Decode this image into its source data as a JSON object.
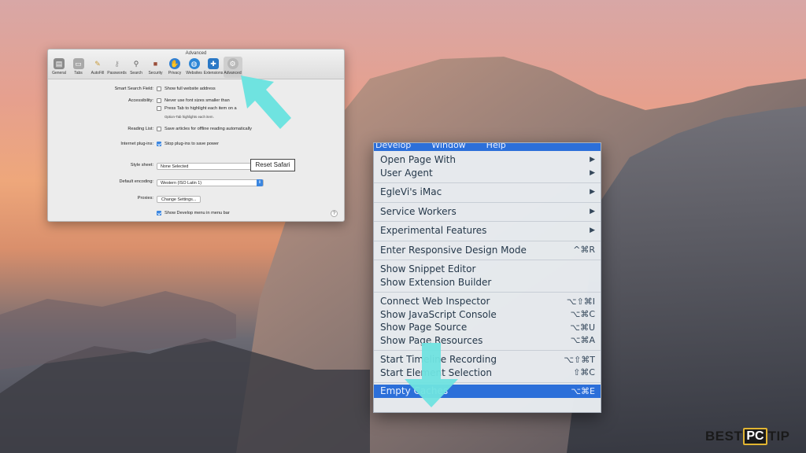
{
  "prefs": {
    "title": "Advanced",
    "tabs": [
      {
        "label": "General",
        "icon": "general-icon"
      },
      {
        "label": "Tabs",
        "icon": "tabs-icon"
      },
      {
        "label": "AutoFill",
        "icon": "autofill-icon"
      },
      {
        "label": "Passwords",
        "icon": "key-icon"
      },
      {
        "label": "Search",
        "icon": "search-icon"
      },
      {
        "label": "Security",
        "icon": "lock-icon"
      },
      {
        "label": "Privacy",
        "icon": "hand-icon"
      },
      {
        "label": "Websites",
        "icon": "globe-icon"
      },
      {
        "label": "Extensions",
        "icon": "puzzle-icon"
      },
      {
        "label": "Advanced",
        "icon": "gear-icon"
      }
    ],
    "smart_search_label": "Smart Search Field:",
    "smart_search_option": "Show full website address",
    "accessibility_label": "Accessibility:",
    "accessibility_opt1": "Never use font sizes smaller than",
    "accessibility_opt2": "Press Tab to highlight each item on a",
    "accessibility_note": "Option-Tab highlights each item.",
    "reading_list_label": "Reading List:",
    "reading_list_option": "Save articles for offline reading automatically",
    "plugins_label": "Internet plug-ins:",
    "plugins_option": "Stop plug-ins to save power",
    "style_sheet_label": "Style sheet:",
    "style_sheet_value": "None Selected",
    "encoding_label": "Default encoding:",
    "encoding_value": "Western (ISO Latin 1)",
    "proxies_label": "Proxies:",
    "proxies_button": "Change Settings...",
    "develop_option": "Show Develop menu in menu bar",
    "tooltip": "Reset Safari",
    "help": "?"
  },
  "menu": {
    "menubar": [
      "Develop",
      "Window",
      "Help"
    ],
    "groups": [
      [
        {
          "label": "Open Page With",
          "sc": "▶"
        },
        {
          "label": "User Agent",
          "sc": "▶"
        }
      ],
      [
        {
          "label": "EgleVi's iMac",
          "sc": "▶"
        }
      ],
      [
        {
          "label": "Service Workers",
          "sc": "▶"
        }
      ],
      [
        {
          "label": "Experimental Features",
          "sc": "▶"
        }
      ],
      [
        {
          "label": "Enter Responsive Design Mode",
          "sc": "^⌘R"
        }
      ],
      [
        {
          "label": "Show Snippet Editor",
          "sc": ""
        },
        {
          "label": "Show Extension Builder",
          "sc": ""
        }
      ],
      [
        {
          "label": "Connect Web Inspector",
          "sc": "⌥⇧⌘I"
        },
        {
          "label": "Show JavaScript Console",
          "sc": "⌥⌘C"
        },
        {
          "label": "Show Page Source",
          "sc": "⌥⌘U"
        },
        {
          "label": "Show Page Resources",
          "sc": "⌥⌘A"
        }
      ],
      [
        {
          "label": "Start Timeline Recording",
          "sc": "⌥⇧⌘T"
        },
        {
          "label": "Start Element Selection",
          "sc": "⇧⌘C"
        }
      ],
      [
        {
          "label": "Empty Caches",
          "sc": "⌥⌘E"
        }
      ]
    ]
  },
  "brand": {
    "left": "BEST",
    "middle": "PC",
    "right": "TIP"
  },
  "colors": {
    "accent": "#2c6fd9",
    "arrow": "#6fe3e0"
  }
}
